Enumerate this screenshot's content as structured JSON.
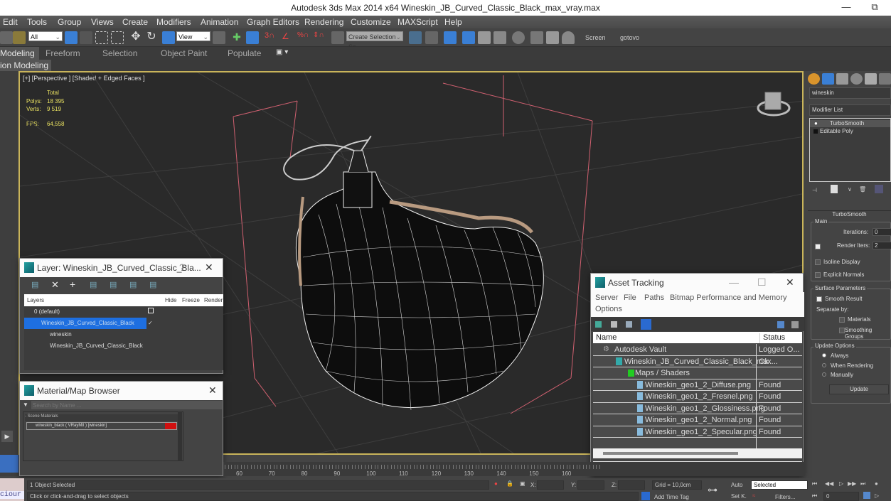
{
  "window": {
    "title": "Autodesk 3ds Max  2014 x64      Wineskin_JB_Curved_Classic_Black_max_vray.max",
    "minimize_icon": "minimize-icon",
    "restore_icon": "restore-icon"
  },
  "menu": [
    "Edit",
    "Tools",
    "Group",
    "Views",
    "Create",
    "Modifiers",
    "Animation",
    "Graph Editors",
    "Rendering",
    "Customize",
    "MAXScript",
    "Help"
  ],
  "toolbar": {
    "selection_filter": "All",
    "reference_coord": "View",
    "named_selection": "Create Selection Se",
    "screen_label": "Screen",
    "gotovo_label": "gotovo"
  },
  "ribbon": {
    "tabs": [
      "Modeling",
      "Freeform",
      "Selection",
      "Object Paint",
      "Populate"
    ],
    "active_tab": "Modeling",
    "sub_label": "ion Modeling"
  },
  "viewport": {
    "label": "[+] [Perspective ] [Shaded + Edged Faces ]",
    "stats": {
      "total_label": "Total",
      "polys_label": "Polys:",
      "polys_value": "18 395",
      "verts_label": "Verts:",
      "verts_value": "9 519",
      "fps_label": "FPS:",
      "fps_value": "64,558"
    }
  },
  "command_panel": {
    "object_name": "wineskin",
    "modifier_list": "Modifier List",
    "stack": [
      "TurboSmooth",
      "Editable Poly"
    ],
    "rollout_title": "TurboSmooth",
    "main_group": "Main",
    "iterations_label": "Iterations:",
    "iterations_value": "0",
    "render_iters_label": "Render Iters:",
    "render_iters_value": "2",
    "render_iters_checked": true,
    "isoline_label": "Isoline Display",
    "isoline_checked": false,
    "explicit_normals_label": "Explicit Normals",
    "explicit_normals_checked": false,
    "surface_group": "Surface Parameters",
    "smooth_result_label": "Smooth Result",
    "smooth_result_checked": true,
    "separate_by_label": "Separate by:",
    "materials_label": "Materials",
    "smoothing_groups_label": "Smoothing Groups",
    "update_group": "Update Options",
    "update_options": [
      "Always",
      "When Rendering",
      "Manually"
    ],
    "update_selected": "Always",
    "update_button": "Update"
  },
  "layer_dialog": {
    "title": "Layer: Wineskin_JB_Curved_Classic_Bla...",
    "help": "?",
    "columns": [
      "Layers",
      "Hide",
      "Freeze",
      "Render"
    ],
    "rows": [
      {
        "name": "0 (default)",
        "indent": 0,
        "selected": false
      },
      {
        "name": "Wineskin_JB_Curved_Classic_Black",
        "indent": 0,
        "selected": true
      },
      {
        "name": "wineskin",
        "indent": 1,
        "selected": false
      },
      {
        "name": "Wineskin_JB_Curved_Classic_Black",
        "indent": 1,
        "selected": false
      }
    ]
  },
  "material_browser": {
    "title": "Material/Map Browser",
    "search_placeholder": "Search by Name ...",
    "group": "- Scene Materials",
    "items": [
      "wineskin_black  ( VRayMtl )  [wineskin]"
    ],
    "accent": "#d01010"
  },
  "asset_tracking": {
    "title": "Asset Tracking",
    "menu": [
      "Server",
      "File",
      "Paths",
      "Bitmap Performance and Memory",
      "Options"
    ],
    "columns": [
      "Name",
      "Status"
    ],
    "rows": [
      {
        "name": "Autodesk Vault",
        "status": "Logged O...",
        "indent": 1
      },
      {
        "name": "Wineskin_JB_Curved_Classic_Black_max...",
        "status": "Ok",
        "indent": 2
      },
      {
        "name": "Maps / Shaders",
        "status": "",
        "indent": 3
      },
      {
        "name": "Wineskin_geo1_2_Diffuse.png",
        "status": "Found",
        "indent": 4
      },
      {
        "name": "Wineskin_geo1_2_Fresnel.png",
        "status": "Found",
        "indent": 4
      },
      {
        "name": "Wineskin_geo1_2_Glossiness.png",
        "status": "Found",
        "indent": 4
      },
      {
        "name": "Wineskin_geo1_2_Normal.png",
        "status": "Found",
        "indent": 4
      },
      {
        "name": "Wineskin_geo1_2_Specular.png",
        "status": "Found",
        "indent": 4
      }
    ]
  },
  "timeline": {
    "ticks": [
      "60",
      "70",
      "80",
      "90",
      "100",
      "110",
      "120",
      "130",
      "140",
      "150",
      "160"
    ]
  },
  "status": {
    "selection": "1 Object Selected",
    "prompt": "Click or click-and-drag to select objects",
    "maxscript": "ciour",
    "x_label": "X:",
    "y_label": "Y:",
    "z_label": "Z:",
    "grid": "Grid = 10,0cm",
    "add_time_tag": "Add Time Tag",
    "auto_label": "Auto",
    "setk_label": "Set K.",
    "key_mode": "Selected",
    "filters_label": "Filters...",
    "frame": "0"
  }
}
